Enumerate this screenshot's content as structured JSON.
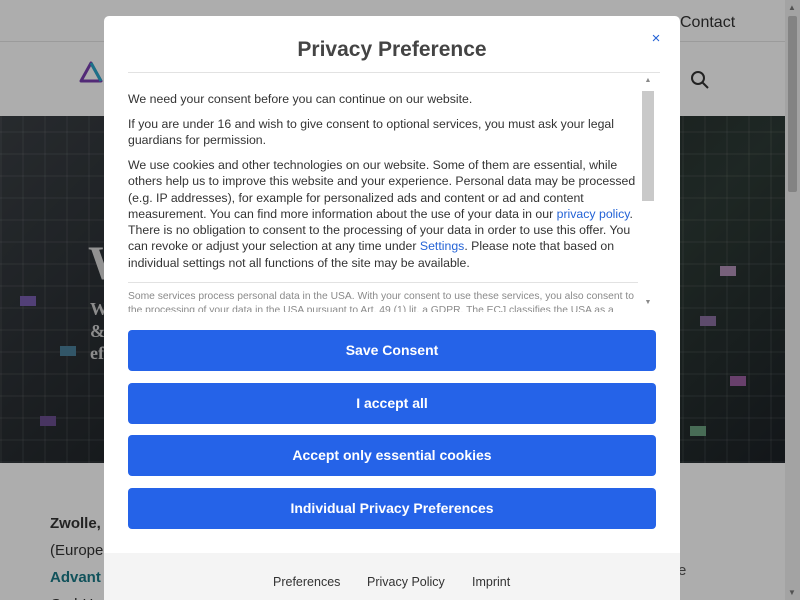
{
  "site": {
    "topbar": {
      "contact_label": "Contact"
    },
    "hero": {
      "title_visible": "W",
      "subtitle_visible": "W\n&\nef"
    },
    "body": {
      "line1": "Zwolle,",
      "line2": "(Europe",
      "line3": "Advant",
      "line4": "GmbH",
      "side_letter": "e"
    },
    "icons": {
      "logo": "brand-logo-icon",
      "search": "search-icon"
    }
  },
  "modal": {
    "title": "Privacy Preference",
    "close_icon": "×",
    "paragraphs": {
      "p1": "We need your consent before you can continue on our website.",
      "p2": "If you are under 16 and wish to give consent to optional services, you must ask your legal guardians for permission.",
      "p3_before_link": "We use cookies and other technologies on our website. Some of them are essential, while others help us to improve this website and your experience. Personal data may be processed (e.g. IP addresses), for example for personalized ads and content or ad and content measurement. You can find more information about the use of your data in our ",
      "p3_link1": "privacy policy",
      "p3_mid": ". There is no obligation to consent to the processing of your data in order to use this offer. You can revoke or adjust your selection at any time under ",
      "p3_link2": "Settings",
      "p3_after": ". Please note that based on individual settings not all functions of the site may be available.",
      "p4": "Some services process personal data in the USA. With your consent to use these services, you also consent to the processing of your data in the USA pursuant to Art. 49 (1) lit. a GDPR. The ECJ classifies the USA as a"
    },
    "buttons": {
      "save": "Save Consent",
      "accept_all": "I accept all",
      "essential": "Accept only essential cookies",
      "individual": "Individual Privacy Preferences"
    },
    "footer": {
      "preferences": "Preferences",
      "privacy_policy": "Privacy Policy",
      "imprint": "Imprint"
    }
  },
  "colors": {
    "accent": "#2563e8",
    "link": "#2463d6",
    "overlay": "rgba(0,0,0,0.32)"
  }
}
